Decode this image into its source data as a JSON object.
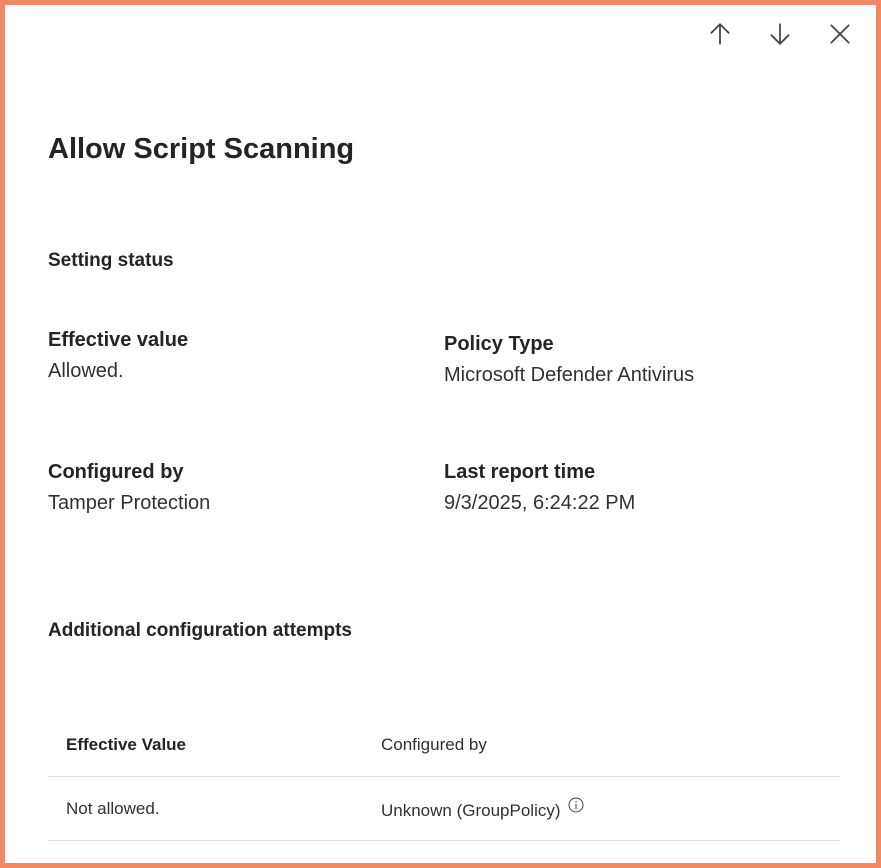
{
  "panel": {
    "title": "Allow Script Scanning",
    "actions": {
      "prev_icon": "arrow-up-icon",
      "next_icon": "arrow-down-icon",
      "close_icon": "close-icon"
    }
  },
  "setting_status": {
    "heading": "Setting status",
    "effective_value": {
      "label": "Effective value",
      "value": "Allowed."
    },
    "policy_type": {
      "label": "Policy Type",
      "value": "Microsoft Defender Antivirus"
    },
    "configured_by": {
      "label": "Configured by",
      "value": "Tamper Protection"
    },
    "last_report_time": {
      "label": "Last report time",
      "value": "9/3/2025, 6:24:22 PM"
    }
  },
  "additional_attempts": {
    "heading": "Additional configuration attempts",
    "columns": [
      "Effective Value",
      "Configured by"
    ],
    "rows": [
      {
        "effective_value": "Not allowed.",
        "configured_by": "Unknown (GroupPolicy)",
        "info_icon": "info-icon"
      }
    ]
  },
  "colors": {
    "border_accent": "#f08866",
    "divider": "#e1dfdd"
  }
}
